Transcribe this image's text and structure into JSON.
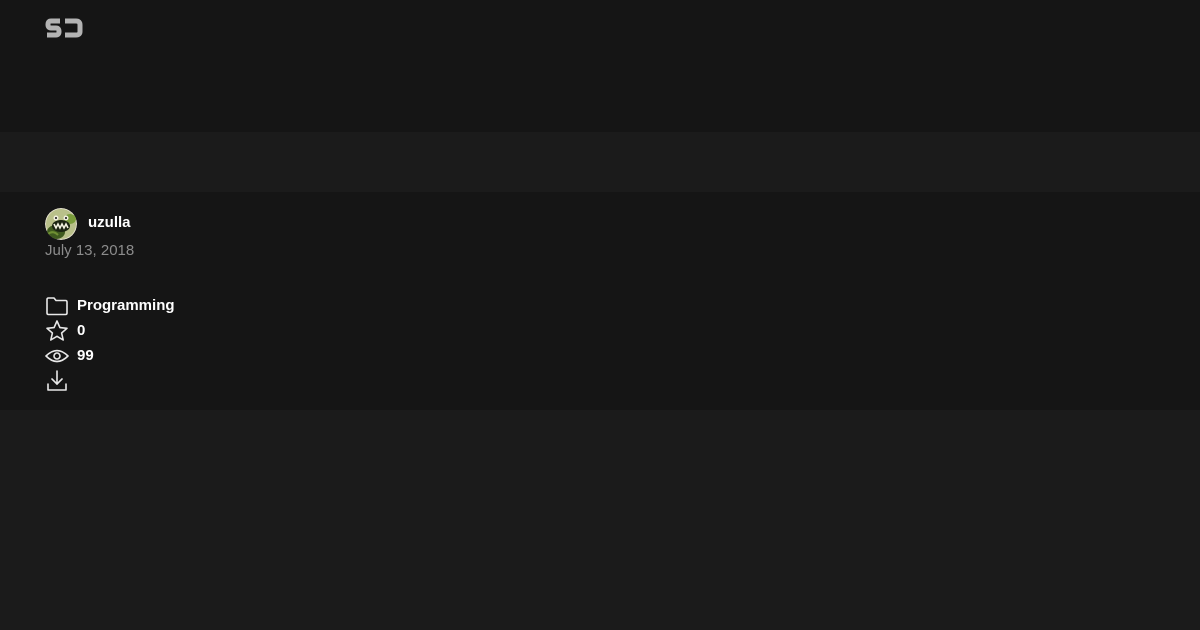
{
  "header": {
    "logo_text": "SJ",
    "logo_icon": "sj-logo-icon"
  },
  "author": {
    "name": "uzulla",
    "avatar_icon": "avatar-image",
    "date": "July 13, 2018"
  },
  "meta": {
    "category": {
      "icon": "folder-icon",
      "label": "Programming"
    },
    "stars": {
      "icon": "star-icon",
      "value": "0"
    },
    "views": {
      "icon": "eye-icon",
      "value": "99"
    },
    "download": {
      "icon": "download-icon",
      "label": ""
    }
  },
  "colors": {
    "background": "#1b1b1b",
    "panel": "#151515",
    "text": "#ffffff",
    "muted_text": "#8c8c8c",
    "logo": "#b3b3b3"
  }
}
